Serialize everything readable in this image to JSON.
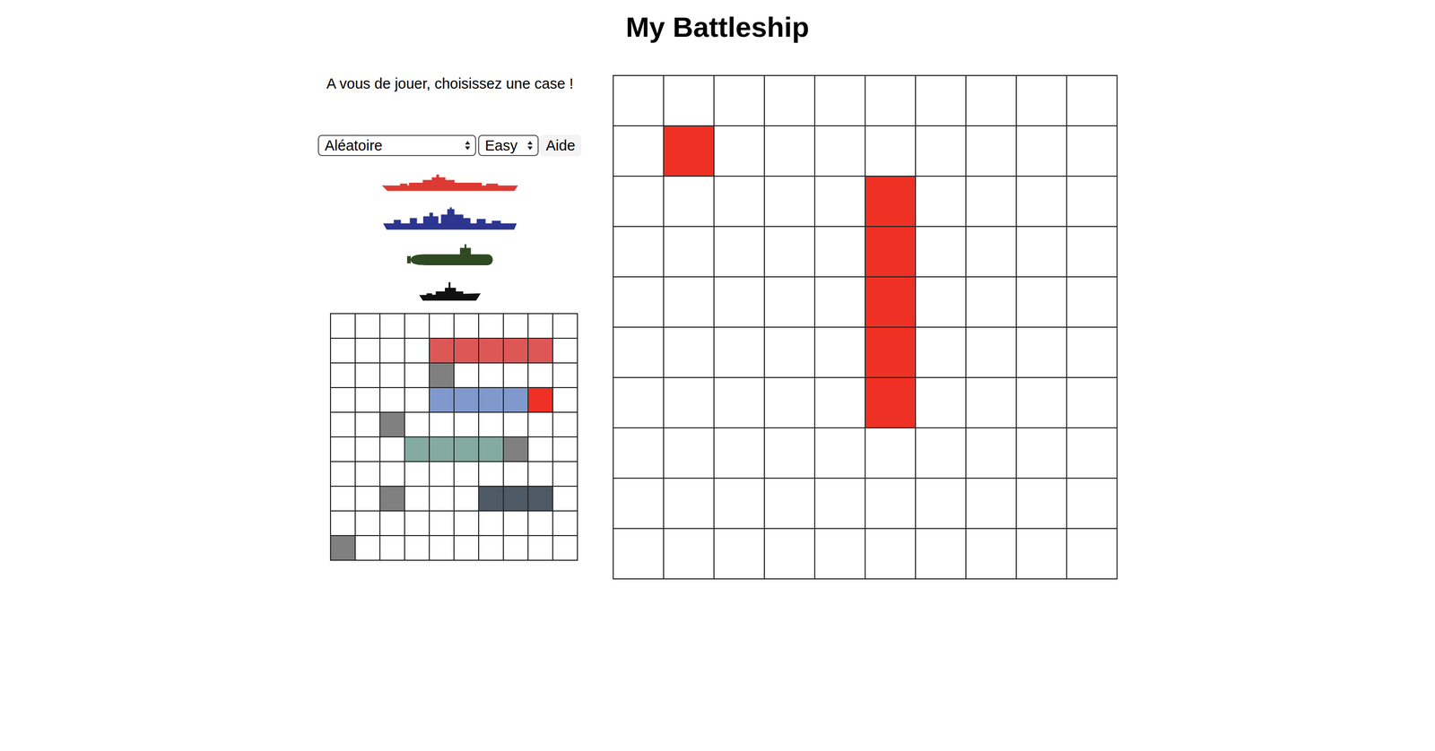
{
  "title": "My Battleship",
  "status": "A vous de jouer, choisissez une case !",
  "controls": {
    "placement": "Aléatoire",
    "difficulty": "Easy",
    "help": "Aide"
  },
  "fleet": [
    {
      "kind": "battleship",
      "color": "#dc3a33"
    },
    {
      "kind": "cruiser",
      "color": "#2c3590"
    },
    {
      "kind": "submarine",
      "color": "#2f4a22"
    },
    {
      "kind": "patrol",
      "color": "#111111"
    }
  ],
  "player_board": {
    "cells": [
      [
        {
          "kind": "water"
        },
        {
          "kind": "water"
        },
        {
          "kind": "water"
        },
        {
          "kind": "water"
        },
        {
          "kind": "water"
        },
        {
          "kind": "water"
        },
        {
          "kind": "water"
        },
        {
          "kind": "water"
        },
        {
          "kind": "water"
        },
        {
          "kind": "water"
        }
      ],
      [
        {
          "kind": "water"
        },
        {
          "kind": "water"
        },
        {
          "kind": "water"
        },
        {
          "kind": "water"
        },
        {
          "kind": "ship",
          "color": "#de5757"
        },
        {
          "kind": "ship",
          "color": "#de5757"
        },
        {
          "kind": "ship",
          "color": "#de5757"
        },
        {
          "kind": "ship",
          "color": "#de5757"
        },
        {
          "kind": "ship",
          "color": "#de5757"
        },
        {
          "kind": "water"
        }
      ],
      [
        {
          "kind": "water"
        },
        {
          "kind": "water"
        },
        {
          "kind": "water"
        },
        {
          "kind": "water"
        },
        {
          "kind": "miss"
        },
        {
          "kind": "water"
        },
        {
          "kind": "water"
        },
        {
          "kind": "water"
        },
        {
          "kind": "water"
        },
        {
          "kind": "water"
        }
      ],
      [
        {
          "kind": "water"
        },
        {
          "kind": "water"
        },
        {
          "kind": "water"
        },
        {
          "kind": "water"
        },
        {
          "kind": "ship",
          "color": "#7f99cc"
        },
        {
          "kind": "ship",
          "color": "#7f99cc"
        },
        {
          "kind": "ship",
          "color": "#7f99cc"
        },
        {
          "kind": "ship",
          "color": "#7f99cc"
        },
        {
          "kind": "hit"
        },
        {
          "kind": "water"
        }
      ],
      [
        {
          "kind": "water"
        },
        {
          "kind": "water"
        },
        {
          "kind": "miss"
        },
        {
          "kind": "water"
        },
        {
          "kind": "water"
        },
        {
          "kind": "water"
        },
        {
          "kind": "water"
        },
        {
          "kind": "water"
        },
        {
          "kind": "water"
        },
        {
          "kind": "water"
        }
      ],
      [
        {
          "kind": "water"
        },
        {
          "kind": "water"
        },
        {
          "kind": "water"
        },
        {
          "kind": "ship",
          "color": "#84aba0"
        },
        {
          "kind": "ship",
          "color": "#84aba0"
        },
        {
          "kind": "ship",
          "color": "#84aba0"
        },
        {
          "kind": "ship",
          "color": "#84aba0"
        },
        {
          "kind": "miss"
        },
        {
          "kind": "water"
        },
        {
          "kind": "water"
        }
      ],
      [
        {
          "kind": "water"
        },
        {
          "kind": "water"
        },
        {
          "kind": "water"
        },
        {
          "kind": "water"
        },
        {
          "kind": "water"
        },
        {
          "kind": "water"
        },
        {
          "kind": "water"
        },
        {
          "kind": "water"
        },
        {
          "kind": "water"
        },
        {
          "kind": "water"
        }
      ],
      [
        {
          "kind": "water"
        },
        {
          "kind": "water"
        },
        {
          "kind": "miss"
        },
        {
          "kind": "water"
        },
        {
          "kind": "water"
        },
        {
          "kind": "water"
        },
        {
          "kind": "ship",
          "color": "#4e5966"
        },
        {
          "kind": "ship",
          "color": "#4e5966"
        },
        {
          "kind": "ship",
          "color": "#4e5966"
        },
        {
          "kind": "water"
        }
      ],
      [
        {
          "kind": "water"
        },
        {
          "kind": "water"
        },
        {
          "kind": "water"
        },
        {
          "kind": "water"
        },
        {
          "kind": "water"
        },
        {
          "kind": "water"
        },
        {
          "kind": "water"
        },
        {
          "kind": "water"
        },
        {
          "kind": "water"
        },
        {
          "kind": "water"
        }
      ],
      [
        {
          "kind": "miss"
        },
        {
          "kind": "water"
        },
        {
          "kind": "water"
        },
        {
          "kind": "water"
        },
        {
          "kind": "water"
        },
        {
          "kind": "water"
        },
        {
          "kind": "water"
        },
        {
          "kind": "water"
        },
        {
          "kind": "water"
        },
        {
          "kind": "water"
        }
      ]
    ]
  },
  "enemy_board": {
    "cells": [
      [
        {
          "kind": "water"
        },
        {
          "kind": "water"
        },
        {
          "kind": "water"
        },
        {
          "kind": "water"
        },
        {
          "kind": "water"
        },
        {
          "kind": "water"
        },
        {
          "kind": "water"
        },
        {
          "kind": "water"
        },
        {
          "kind": "water"
        },
        {
          "kind": "water"
        }
      ],
      [
        {
          "kind": "water"
        },
        {
          "kind": "hit"
        },
        {
          "kind": "water"
        },
        {
          "kind": "water"
        },
        {
          "kind": "water"
        },
        {
          "kind": "water"
        },
        {
          "kind": "water"
        },
        {
          "kind": "water"
        },
        {
          "kind": "water"
        },
        {
          "kind": "water"
        }
      ],
      [
        {
          "kind": "water"
        },
        {
          "kind": "water"
        },
        {
          "kind": "water"
        },
        {
          "kind": "water"
        },
        {
          "kind": "water"
        },
        {
          "kind": "hit"
        },
        {
          "kind": "water"
        },
        {
          "kind": "water"
        },
        {
          "kind": "water"
        },
        {
          "kind": "water"
        }
      ],
      [
        {
          "kind": "water"
        },
        {
          "kind": "water"
        },
        {
          "kind": "water"
        },
        {
          "kind": "water"
        },
        {
          "kind": "water"
        },
        {
          "kind": "hit"
        },
        {
          "kind": "water"
        },
        {
          "kind": "water"
        },
        {
          "kind": "water"
        },
        {
          "kind": "water"
        }
      ],
      [
        {
          "kind": "water"
        },
        {
          "kind": "water"
        },
        {
          "kind": "water"
        },
        {
          "kind": "water"
        },
        {
          "kind": "water"
        },
        {
          "kind": "hit"
        },
        {
          "kind": "water"
        },
        {
          "kind": "water"
        },
        {
          "kind": "water"
        },
        {
          "kind": "water"
        }
      ],
      [
        {
          "kind": "water"
        },
        {
          "kind": "water"
        },
        {
          "kind": "water"
        },
        {
          "kind": "water"
        },
        {
          "kind": "water"
        },
        {
          "kind": "hit"
        },
        {
          "kind": "water"
        },
        {
          "kind": "water"
        },
        {
          "kind": "water"
        },
        {
          "kind": "water"
        }
      ],
      [
        {
          "kind": "water"
        },
        {
          "kind": "water"
        },
        {
          "kind": "water"
        },
        {
          "kind": "water"
        },
        {
          "kind": "water"
        },
        {
          "kind": "hit"
        },
        {
          "kind": "water"
        },
        {
          "kind": "water"
        },
        {
          "kind": "water"
        },
        {
          "kind": "water"
        }
      ],
      [
        {
          "kind": "water"
        },
        {
          "kind": "water"
        },
        {
          "kind": "water"
        },
        {
          "kind": "water"
        },
        {
          "kind": "water"
        },
        {
          "kind": "water"
        },
        {
          "kind": "water"
        },
        {
          "kind": "water"
        },
        {
          "kind": "water"
        },
        {
          "kind": "water"
        }
      ],
      [
        {
          "kind": "water"
        },
        {
          "kind": "water"
        },
        {
          "kind": "water"
        },
        {
          "kind": "water"
        },
        {
          "kind": "water"
        },
        {
          "kind": "water"
        },
        {
          "kind": "water"
        },
        {
          "kind": "water"
        },
        {
          "kind": "water"
        },
        {
          "kind": "water"
        }
      ],
      [
        {
          "kind": "water"
        },
        {
          "kind": "water"
        },
        {
          "kind": "water"
        },
        {
          "kind": "water"
        },
        {
          "kind": "water"
        },
        {
          "kind": "water"
        },
        {
          "kind": "water"
        },
        {
          "kind": "water"
        },
        {
          "kind": "water"
        },
        {
          "kind": "water"
        }
      ]
    ]
  }
}
